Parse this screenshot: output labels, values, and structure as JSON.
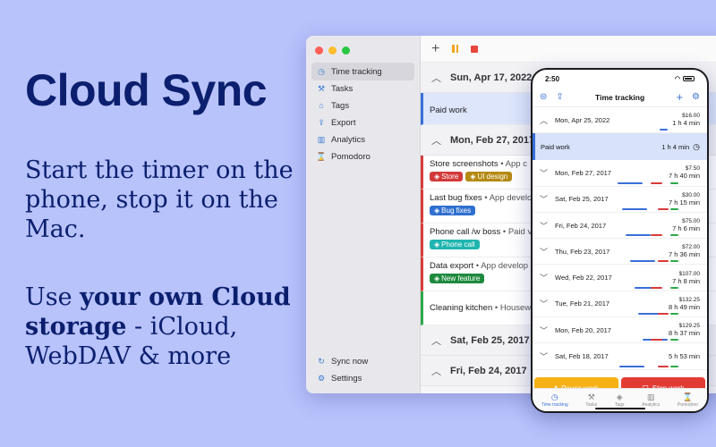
{
  "headline": "Cloud Sync",
  "subtitle": "Start the timer on the phone, stop it on the Mac.",
  "subtitle2_prefix": "Use ",
  "subtitle2_bold": "your own Cloud storage",
  "subtitle2_suffix": " - iCloud, WebDAV & more",
  "colors": {
    "background": "#b8c2fb",
    "headline": "#0b1f6e",
    "accent": "#3a6fd8",
    "pause": "#f5b116",
    "stop": "#e23b34"
  },
  "mac": {
    "sidebar": [
      {
        "label": "Time tracking",
        "icon": "clock-icon",
        "glyph": "◷",
        "active": true
      },
      {
        "label": "Tasks",
        "icon": "wrench-icon",
        "glyph": "⚒",
        "active": false
      },
      {
        "label": "Tags",
        "icon": "tag-icon",
        "glyph": "⌂",
        "active": false
      },
      {
        "label": "Export",
        "icon": "share-icon",
        "glyph": "⇪",
        "active": false
      },
      {
        "label": "Analytics",
        "icon": "bar-chart-icon",
        "glyph": "▥",
        "active": false
      },
      {
        "label": "Pomodoro",
        "icon": "hourglass-icon",
        "glyph": "⌛",
        "active": false
      }
    ],
    "sidebar_bottom": [
      {
        "label": "Sync now",
        "icon": "sync-icon",
        "glyph": "↻"
      },
      {
        "label": "Settings",
        "icon": "gear-icon",
        "glyph": "⚙"
      }
    ],
    "days": [
      {
        "date": "Sun, Apr 17, 2022",
        "entries": [
          {
            "title": "Paid work",
            "project": "",
            "paid": true,
            "color": "#3a6fd8",
            "tags": []
          }
        ]
      },
      {
        "date": "Mon, Feb 27, 2017",
        "entries": [
          {
            "title": "Store screenshots",
            "project": " • App c",
            "color": "#d93b3b",
            "tags": [
              {
                "label": "Store",
                "color": "#d23a3a"
              },
              {
                "label": "UI design",
                "color": "#b58a12"
              }
            ]
          },
          {
            "title": "Last bug fixes",
            "project": " • App develo",
            "color": "#d93b3b",
            "tags": [
              {
                "label": "Bug fixes",
                "color": "#2f6fd0"
              }
            ]
          },
          {
            "title": "Phone call /w boss",
            "project": " • Paid v",
            "color": "#d93b3b",
            "tags": [
              {
                "label": "Phone call",
                "color": "#1fb5b0"
              }
            ]
          },
          {
            "title": "Data export",
            "project": " • App develop",
            "color": "#d93b3b",
            "tags": [
              {
                "label": "New feature",
                "color": "#1f8a3e"
              }
            ]
          },
          {
            "title": "Cleaning kitchen",
            "project": " • Housew",
            "color": "#2ea84a",
            "tags": []
          }
        ]
      },
      {
        "date": "Sat, Feb 25, 2017",
        "entries": []
      },
      {
        "date": "Fri, Feb 24, 2017",
        "entries": []
      }
    ]
  },
  "phone": {
    "time": "2:50",
    "nav_title": "Time tracking",
    "top_row": {
      "date": "Mon, Apr 25, 2022",
      "amount": "$16.00",
      "total": "1 h 4 min"
    },
    "paid_row": {
      "label": "Paid work",
      "duration": "1 h 4 min"
    },
    "rows": [
      {
        "date": "Mon, Feb 27, 2017",
        "amount": "$7.50",
        "total": "7 h 40 min"
      },
      {
        "date": "Sat, Feb 25, 2017",
        "amount": "$30.00",
        "total": "7 h 15 min"
      },
      {
        "date": "Fri, Feb 24, 2017",
        "amount": "$75.00",
        "total": "7 h 6 min"
      },
      {
        "date": "Thu, Feb 23, 2017",
        "amount": "$72.00",
        "total": "7 h 36 min"
      },
      {
        "date": "Wed, Feb 22, 2017",
        "amount": "$107.00",
        "total": "7 h 8 min"
      },
      {
        "date": "Tue, Feb 21, 2017",
        "amount": "$132.25",
        "total": "8 h 49 min"
      },
      {
        "date": "Mon, Feb 20, 2017",
        "amount": "$129.25",
        "total": "8 h 37 min"
      },
      {
        "date": "Sat, Feb 18, 2017",
        "amount": "",
        "total": "5 h 53 min"
      }
    ],
    "pause_label": "Pause work",
    "stop_label": "Stop work",
    "tabs": [
      {
        "label": "Time tracking",
        "icon": "clock-icon",
        "glyph": "◷",
        "active": true
      },
      {
        "label": "Tasks",
        "icon": "wrench-icon",
        "glyph": "⚒",
        "active": false
      },
      {
        "label": "Tags",
        "icon": "tag-icon",
        "glyph": "◈",
        "active": false
      },
      {
        "label": "Analytics",
        "icon": "bar-chart-icon",
        "glyph": "▥",
        "active": false
      },
      {
        "label": "Pomodoro",
        "icon": "hourglass-icon",
        "glyph": "⌛",
        "active": false
      }
    ]
  }
}
